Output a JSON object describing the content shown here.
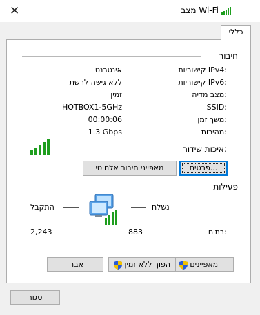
{
  "window": {
    "title": "מצב Wi-Fi",
    "close_glyph": "✕",
    "icon": "wifi-signal-icon"
  },
  "tab": {
    "label": "כללי"
  },
  "connection": {
    "heading": "חיבור",
    "rows": [
      {
        "label": "קישוריות IPv4:",
        "value": "אינטרנט"
      },
      {
        "label": "קישוריות IPv6:",
        "value": "ללא גישה לרשת"
      },
      {
        "label": "מצב מדיה:",
        "value": "זמין"
      },
      {
        "label": "SSID:",
        "value": "HOTBOX1-5GHz"
      },
      {
        "label": "משך זמן:",
        "value": "00:00:06"
      },
      {
        "label": "מהירות:",
        "value": "1.3 Gbps"
      }
    ],
    "signal_label": "איכות שידור:",
    "signal_bars_lit": 5,
    "signal_bars_total": 5,
    "signal_color": "#1e9e1e",
    "details_button": "פרטים...",
    "wireless_props_button": "מאפייני חיבור אלחוטי"
  },
  "activity": {
    "heading": "פעילות",
    "sent_label": "נשלח",
    "received_label": "התקבל",
    "bytes_label": "בתים:",
    "sent_bytes": "883",
    "received_bytes": "2,243",
    "icon": "network-computers-icon"
  },
  "buttons": {
    "properties": "מאפיינים",
    "disable": "הפוך ללא זמין",
    "diagnose": "אבחן",
    "close": "סגור"
  },
  "colors": {
    "accent": "#0078d7",
    "shield_blue": "#2a5bd7",
    "shield_yellow": "#f2c200"
  }
}
